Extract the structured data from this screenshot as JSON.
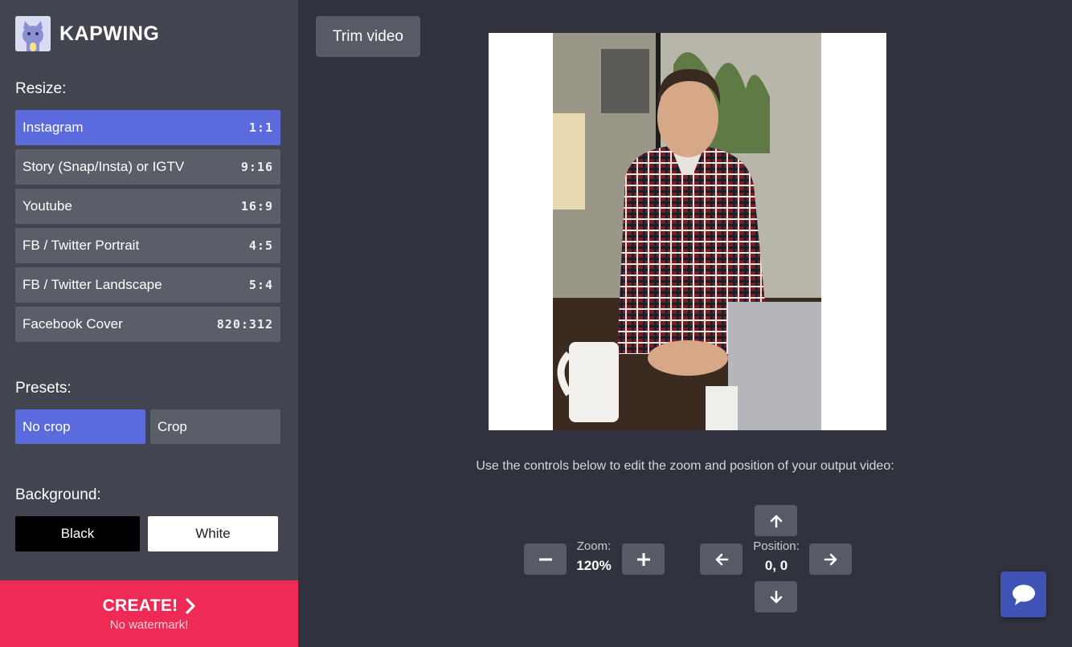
{
  "brand": {
    "name": "KAPWING"
  },
  "sidebar": {
    "resize_title": "Resize:",
    "resize_items": [
      {
        "label": "Instagram",
        "ratio": "1:1",
        "active": true
      },
      {
        "label": "Story (Snap/Insta) or IGTV",
        "ratio": "9:16",
        "active": false
      },
      {
        "label": "Youtube",
        "ratio": "16:9",
        "active": false
      },
      {
        "label": "FB / Twitter Portrait",
        "ratio": "4:5",
        "active": false
      },
      {
        "label": "FB / Twitter Landscape",
        "ratio": "5:4",
        "active": false
      },
      {
        "label": "Facebook Cover",
        "ratio": "820:312",
        "active": false
      }
    ],
    "presets_title": "Presets:",
    "presets": [
      {
        "label": "No crop",
        "active": true
      },
      {
        "label": "Crop",
        "active": false
      }
    ],
    "background_title": "Background:",
    "backgrounds": [
      {
        "label": "Black"
      },
      {
        "label": "White"
      }
    ],
    "create": {
      "label": "CREATE!",
      "sub": "No watermark!"
    }
  },
  "main": {
    "trim_label": "Trim video",
    "instructions": "Use the controls below to edit the zoom and position of your output video:",
    "zoom": {
      "label": "Zoom:",
      "value": "120%"
    },
    "position": {
      "label": "Position:",
      "value": "0, 0"
    }
  },
  "colors": {
    "accent": "#5b6bdd",
    "create": "#ee2a55",
    "sidebar": "#42454f",
    "main_bg": "#30333d",
    "chat": "#3f52b5"
  }
}
